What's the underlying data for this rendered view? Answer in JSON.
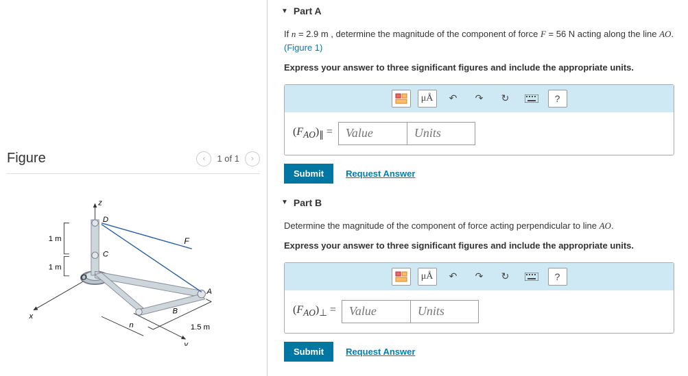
{
  "figure": {
    "title": "Figure",
    "nav_text": "1 of 1",
    "labels": {
      "z": "z",
      "x": "x",
      "y": "y",
      "F": "F",
      "A": "A",
      "B": "B",
      "C": "C",
      "D": "D",
      "O": "O",
      "n": "n",
      "dim1m_a": "1 m",
      "dim1m_b": "1 m",
      "dim15m": "1.5 m"
    }
  },
  "partA": {
    "title": "Part A",
    "prompt_pre": "If ",
    "prompt_var1": "n",
    "prompt_mid1": " = 2.9 m , determine the magnitude of the component of force ",
    "prompt_var2": "F",
    "prompt_mid2": " = 56 N acting along the line ",
    "prompt_var3": "AO",
    "prompt_post": ". ",
    "figure_link": "(Figure 1)",
    "instruction": "Express your answer to three significant figures and include the appropriate units.",
    "eq_label_html": "(F_AO)∥ =",
    "value_ph": "Value",
    "units_ph": "Units",
    "submit": "Submit",
    "request": "Request Answer",
    "mu_label": "μÅ"
  },
  "partB": {
    "title": "Part B",
    "prompt_pre": "Determine the magnitude of the component of force acting perpendicular to line ",
    "prompt_var": "AO",
    "prompt_post": ".",
    "instruction": "Express your answer to three significant figures and include the appropriate units.",
    "eq_label_html": "(F_AO)⊥ =",
    "value_ph": "Value",
    "units_ph": "Units",
    "submit": "Submit",
    "request": "Request Answer",
    "mu_label": "μÅ"
  }
}
